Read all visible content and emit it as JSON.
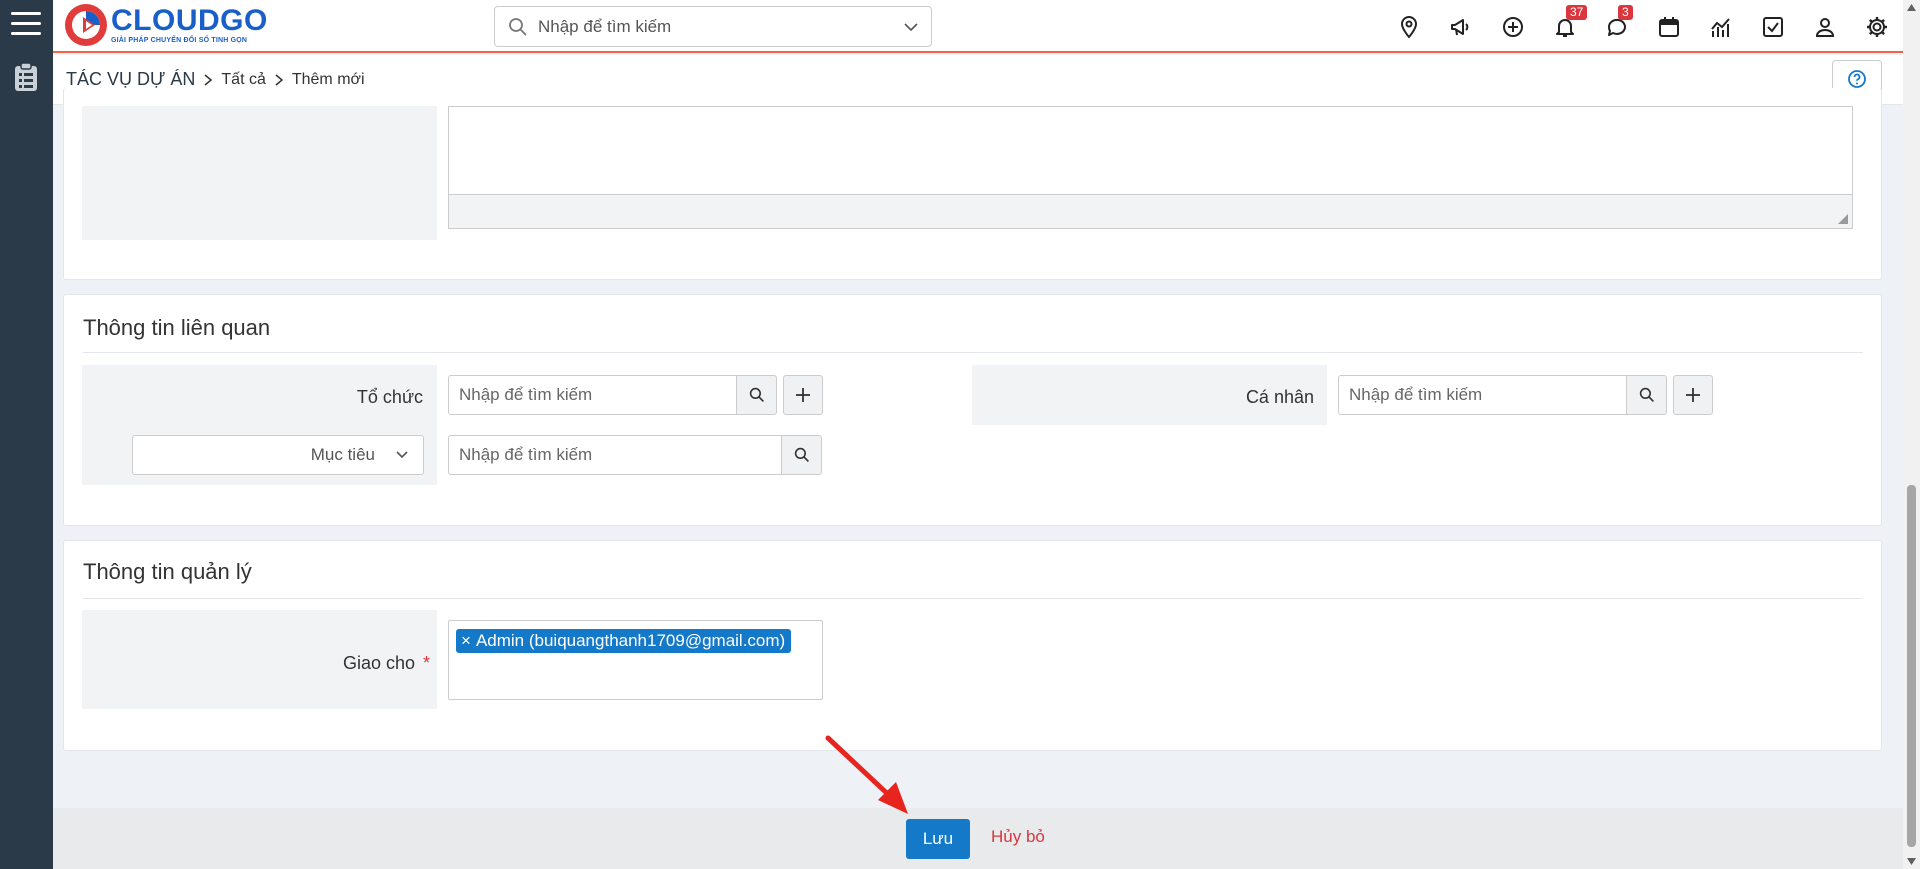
{
  "brand": {
    "name": "CLOUDGO",
    "tagline": "GIẢI PHÁP CHUYỂN ĐỔI SỐ TINH GỌN",
    "accent": "#1479c9",
    "header_border": "#e8694a",
    "sidebar_bg": "#2b3a48"
  },
  "top_search": {
    "placeholder": "Nhập để tìm kiếm"
  },
  "top_icons": [
    {
      "name": "location-pin-icon"
    },
    {
      "name": "megaphone-icon"
    },
    {
      "name": "plus-circle-icon"
    },
    {
      "name": "bell-icon",
      "badge": "37"
    },
    {
      "name": "chat-icon",
      "badge": "3"
    },
    {
      "name": "calendar-icon"
    },
    {
      "name": "chart-icon"
    },
    {
      "name": "checkbox-icon"
    },
    {
      "name": "user-icon"
    },
    {
      "name": "gear-icon"
    }
  ],
  "breadcrumb": {
    "root": "TÁC VỤ DỰ ÁN",
    "items": [
      "Tất cả",
      "Thêm mới"
    ]
  },
  "section_related": {
    "title": "Thông tin liên quan",
    "organization_label": "Tổ chức",
    "organization_placeholder": "Nhập để tìm kiếm",
    "individual_label": "Cá nhân",
    "individual_placeholder": "Nhập để tìm kiếm",
    "target_select": "Mục tiêu",
    "target_placeholder": "Nhập để tìm kiếm"
  },
  "section_management": {
    "title": "Thông tin quản lý",
    "assign_label": "Giao cho",
    "required_mark": "*",
    "assignee_remove": "×",
    "assignee_tag": "Admin (buiquangthanh1709@gmail.com)"
  },
  "footer": {
    "save_label": "Lưu",
    "cancel_label": "Hủy bỏ"
  }
}
